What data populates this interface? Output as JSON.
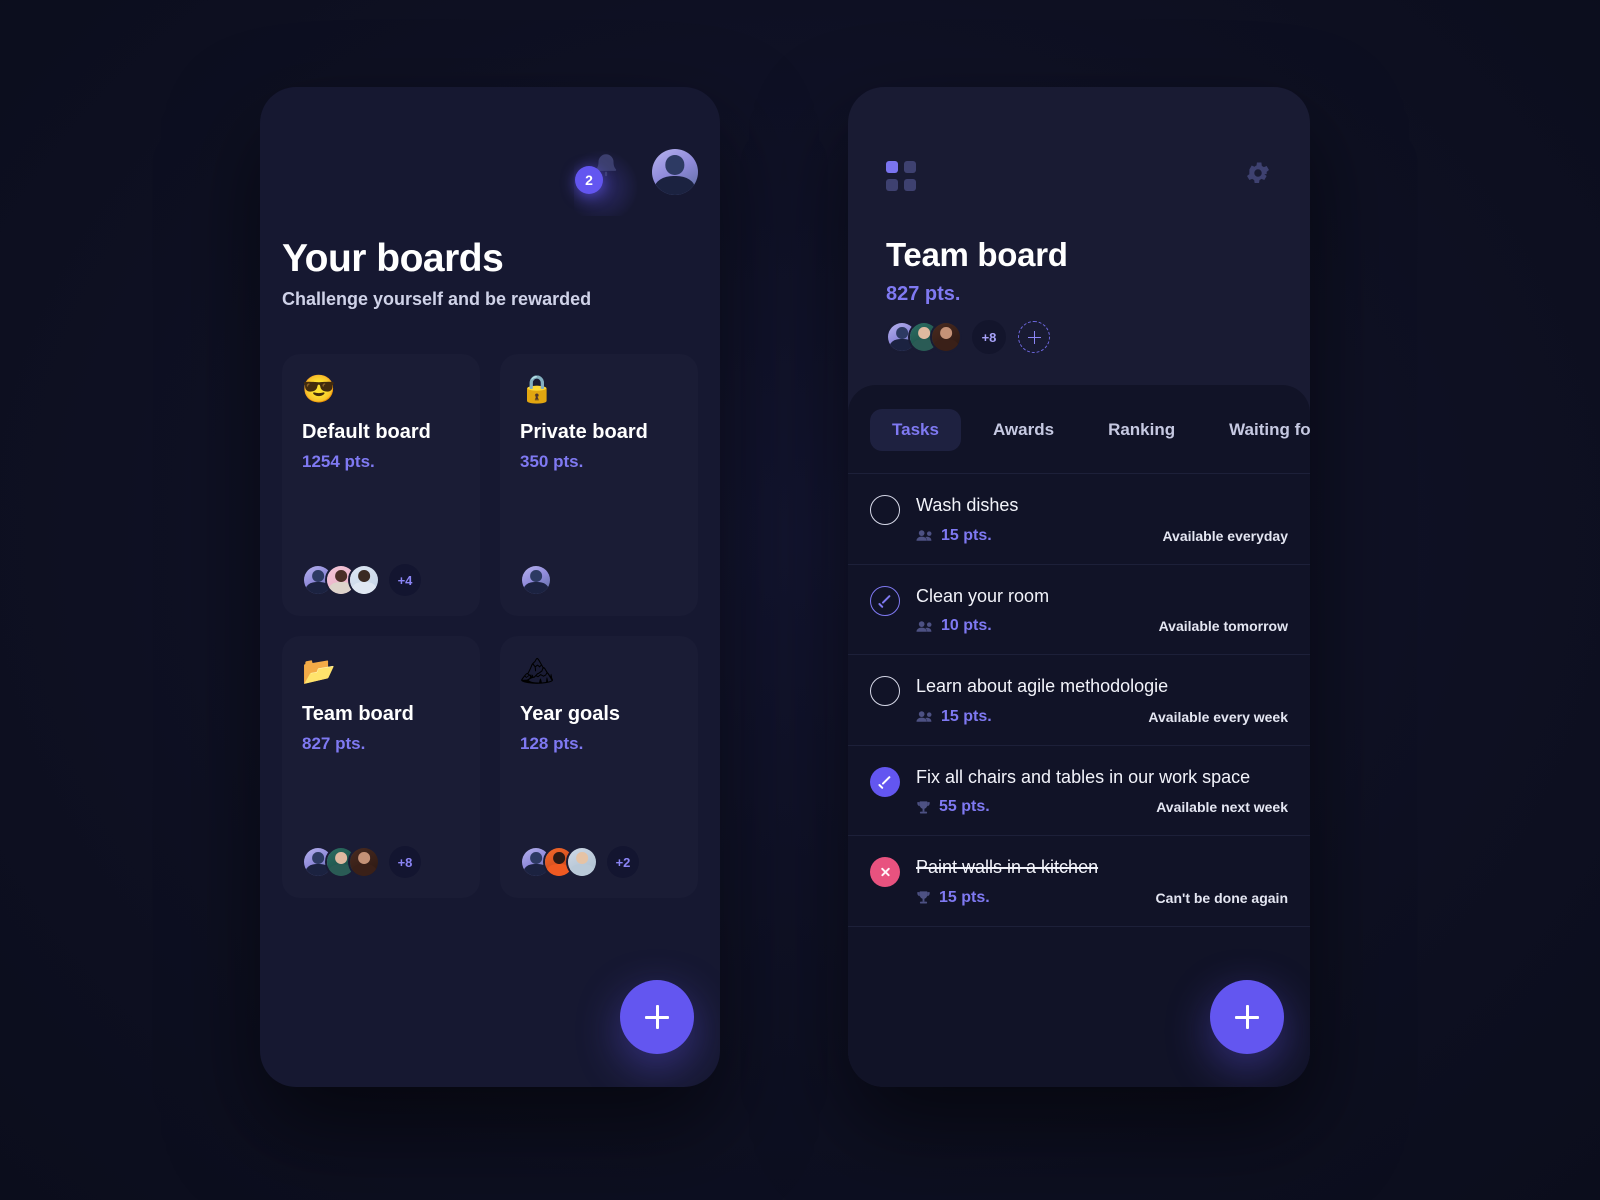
{
  "theme": {
    "bg": "#0e1022",
    "panel": "#191b33",
    "card": "#1a1c35",
    "sheet": "#111327",
    "accent": "#6356f0",
    "accent_text": "#7f79f2",
    "danger": "#e8527f",
    "divider": "#1d2039"
  },
  "left_panel": {
    "notification_badge": "2",
    "bell_icon": "bell-icon",
    "avatar_icon": "user-avatar",
    "title": "Your boards",
    "subtitle": "Challenge yourself and be rewarded",
    "boards": [
      {
        "emoji": "😎",
        "emoji_name": "sunglasses-face-emoji",
        "title": "Default board",
        "points": "1254 pts.",
        "members": [
          "ph-a",
          "ph-b",
          "ph-c"
        ],
        "overflow": "+4"
      },
      {
        "emoji": "🔒",
        "emoji_name": "lock-emoji",
        "title": "Private board",
        "points": "350 pts.",
        "members": [
          "ph-a"
        ],
        "overflow": ""
      },
      {
        "emoji": "📂",
        "emoji_name": "open-folder-emoji",
        "title": "Team board",
        "points": "827 pts.",
        "members": [
          "ph-a",
          "ph-d",
          "ph-e"
        ],
        "overflow": "+8"
      },
      {
        "emoji": "🏔",
        "emoji_name": "mountain-emoji",
        "title": "Year goals",
        "points": "128 pts.",
        "members": [
          "ph-a",
          "ph-f",
          "ph-g"
        ],
        "overflow": "+2"
      }
    ],
    "add_board_label": "+"
  },
  "right_panel": {
    "grid_icon": "grid-apps-icon",
    "settings_icon": "gear-icon",
    "title": "Team board",
    "points": "827 pts.",
    "members": [
      "ph-a",
      "ph-d",
      "ph-e"
    ],
    "overflow": "+8",
    "add_member_label": "+",
    "tabs": [
      {
        "label": "Tasks",
        "active": true
      },
      {
        "label": "Awards",
        "active": false
      },
      {
        "label": "Ranking",
        "active": false
      },
      {
        "label": "Waiting for",
        "active": false
      }
    ],
    "tasks": [
      {
        "name": "Wash dishes",
        "state": "empty",
        "points": "15 pts.",
        "points_icon": "people-icon",
        "availability": "Available everyday",
        "struck": false
      },
      {
        "name": "Clean your room",
        "state": "outline-check",
        "points": "10 pts.",
        "points_icon": "people-icon",
        "availability": "Available tomorrow",
        "struck": false
      },
      {
        "name": "Learn about agile methodologie",
        "state": "empty",
        "points": "15 pts.",
        "points_icon": "people-icon",
        "availability": "Available every week",
        "struck": false
      },
      {
        "name": "Fix all chairs and tables in our work space",
        "state": "filled-check",
        "points": "55 pts.",
        "points_icon": "trophy-icon",
        "availability": "Available next week",
        "struck": false
      },
      {
        "name": "Paint walls in a kitchen",
        "state": "fail",
        "points": "15 pts.",
        "points_icon": "trophy-icon",
        "availability": "Can't be done again",
        "struck": true
      }
    ],
    "add_task_label": "+"
  }
}
